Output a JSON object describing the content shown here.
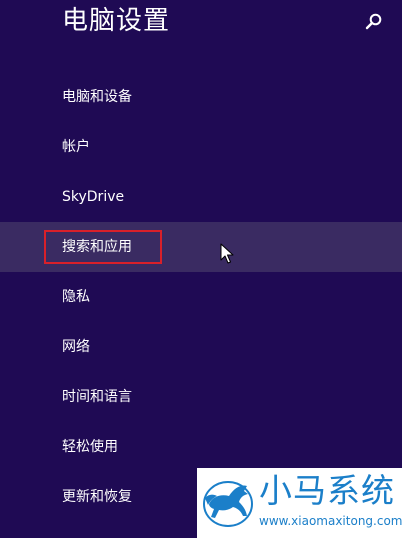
{
  "header": {
    "title": "电脑设置",
    "search_icon": "search-icon"
  },
  "nav": {
    "items": [
      {
        "label": "电脑和设备"
      },
      {
        "label": "帐户"
      },
      {
        "label": "SkyDrive"
      },
      {
        "label": "搜索和应用",
        "selected": true
      },
      {
        "label": "隐私"
      },
      {
        "label": "网络"
      },
      {
        "label": "时间和语言"
      },
      {
        "label": "轻松使用"
      },
      {
        "label": "更新和恢复"
      }
    ]
  },
  "watermark": {
    "name": "小马系统",
    "url": "www.xiaomaxitong.com"
  },
  "colors": {
    "background": "#1f0a54",
    "selected_row": "#3a2b62",
    "highlight_border": "#d9202a",
    "watermark_blue": "#1b7fc9"
  }
}
